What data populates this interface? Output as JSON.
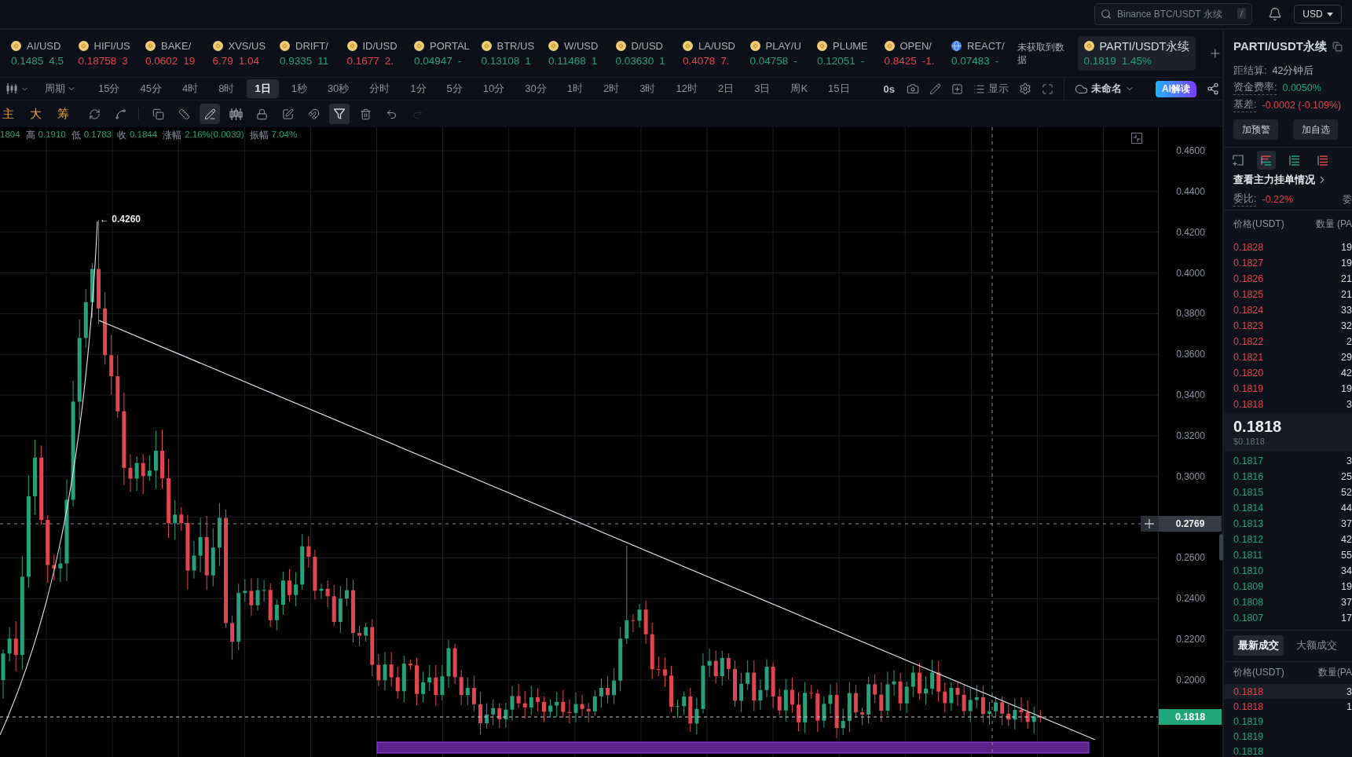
{
  "top_bar": {
    "search": {
      "placeholder": "Binance BTC/USDT 永续",
      "shortcut": "/"
    },
    "currency": "USD"
  },
  "tickers": [
    {
      "kind": "coin",
      "symbol": "AI/USD",
      "price": "0.1485",
      "change": "4.5",
      "rising": true,
      "selected": false
    },
    {
      "kind": "coin",
      "symbol": "HIFI/US",
      "price": "0.18758",
      "change": "3",
      "rising": false,
      "selected": false
    },
    {
      "kind": "coin",
      "symbol": "BAKE/",
      "price": "0.0602",
      "change": "19",
      "rising": false,
      "selected": false
    },
    {
      "kind": "coin",
      "symbol": "XVS/US",
      "price": "6.79",
      "change": "1.04",
      "rising": false,
      "selected": false
    },
    {
      "kind": "coin",
      "symbol": "DRIFT/",
      "price": "0.9335",
      "change": "11",
      "rising": true,
      "selected": false
    },
    {
      "kind": "coin",
      "symbol": "ID/USD",
      "price": "0.1677",
      "change": "2.",
      "rising": false,
      "selected": false
    },
    {
      "kind": "coin",
      "symbol": "PORTAL",
      "price": "0.04947",
      "change": "-",
      "rising": true,
      "selected": false
    },
    {
      "kind": "coin",
      "symbol": "BTR/US",
      "price": "0.13108",
      "change": "1",
      "rising": true,
      "selected": false
    },
    {
      "kind": "coin",
      "symbol": "W/USD",
      "price": "0.11468",
      "change": "1",
      "rising": true,
      "selected": false
    },
    {
      "kind": "coin",
      "symbol": "D/USD",
      "price": "0.03630",
      "change": "1",
      "rising": true,
      "selected": false
    },
    {
      "kind": "coin",
      "symbol": "LA/USD",
      "price": "0.4078",
      "change": "7.",
      "rising": false,
      "selected": false
    },
    {
      "kind": "coin",
      "symbol": "PLAY/U",
      "price": "0.04758",
      "change": "-",
      "rising": true,
      "selected": false
    },
    {
      "kind": "coin",
      "symbol": "PLUME",
      "price": "0.12051",
      "change": "-",
      "rising": true,
      "selected": false
    },
    {
      "kind": "coin",
      "symbol": "OPEN/",
      "price": "0.8425",
      "change": "-1.",
      "rising": false,
      "selected": false
    },
    {
      "kind": "globe",
      "symbol": "REACT/",
      "price": "0.07483",
      "change": "-",
      "rising": true,
      "selected": false
    },
    {
      "kind": "notice",
      "label": "未获取到数据",
      "selected": false
    },
    {
      "kind": "coin",
      "symbol": "PARTI/USDT永续",
      "price": "0.1819",
      "change": "1.45%",
      "rising": true,
      "selected": true
    }
  ],
  "period_bar": {
    "period_menu": "周期",
    "periods": [
      {
        "label": "15分",
        "selected": false
      },
      {
        "label": "45分",
        "selected": false
      },
      {
        "label": "4时",
        "selected": false
      },
      {
        "label": "8时",
        "selected": false
      },
      {
        "label": "1日",
        "selected": true
      },
      {
        "label": "1秒",
        "selected": false
      },
      {
        "label": "30秒",
        "selected": false
      },
      {
        "label": "分时",
        "selected": false
      },
      {
        "label": "1分",
        "selected": false
      },
      {
        "label": "5分",
        "selected": false
      },
      {
        "label": "10分",
        "selected": false
      },
      {
        "label": "30分",
        "selected": false
      },
      {
        "label": "1时",
        "selected": false
      },
      {
        "label": "2时",
        "selected": false
      },
      {
        "label": "3时",
        "selected": false
      },
      {
        "label": "12时",
        "selected": false
      },
      {
        "label": "2日",
        "selected": false
      },
      {
        "label": "3日",
        "selected": false
      },
      {
        "label": "周K",
        "selected": false
      },
      {
        "label": "15日",
        "selected": false
      }
    ],
    "countdown": "0s",
    "display_label": "显示",
    "layout_name": "未命名",
    "ai_button": "AI解读"
  },
  "tool_bar": {
    "indicator_buttons": [
      "主",
      "大",
      "筹"
    ],
    "tools": [
      {
        "selected": false,
        "disabled": false
      },
      {
        "selected": false,
        "disabled": false
      },
      {
        "selected": false,
        "disabled": false
      },
      {
        "selected": false,
        "disabled": false
      },
      {
        "selected": true,
        "disabled": false
      },
      {
        "selected": false,
        "disabled": false
      },
      {
        "selected": false,
        "disabled": false
      },
      {
        "selected": false,
        "disabled": false
      },
      {
        "selected": false,
        "disabled": false
      },
      {
        "selected": true,
        "disabled": false
      },
      {
        "selected": false,
        "disabled": false
      },
      {
        "selected": false,
        "disabled": false
      },
      {
        "selected": false,
        "disabled": true
      }
    ]
  },
  "legend": [
    {
      "value": "1804"
    },
    {
      "label": "高",
      "value": "0.1910"
    },
    {
      "label": "低",
      "value": "0.1783"
    },
    {
      "label": "收",
      "value": "0.1844"
    },
    {
      "label": "涨幅",
      "value": "2.16%(0.0039)"
    },
    {
      "label": "振幅",
      "value": "7.04%"
    }
  ],
  "chart": {
    "peak_label": "← 0.4260",
    "axis_upper": [
      "0.4600",
      "0.4400",
      "0.4200",
      "0.4000",
      "0.3800",
      "0.3600",
      "0.3400",
      "0.3200",
      "0.3000"
    ],
    "crosshair_price": "0.2769",
    "axis_lower": [
      "0.2600",
      "0.2400",
      "0.2200",
      "0.2000"
    ],
    "last_price": "0.1818"
  },
  "panel": {
    "title": "PARTI/USDT永续",
    "stats": [
      {
        "label": "距结算:",
        "value": "42分钟后",
        "color": "#a7acb7",
        "tooltip": false
      },
      {
        "label": "资金费率:",
        "value": "0.0050%",
        "color": "#26a17b",
        "tooltip": true
      },
      {
        "label": "基差:",
        "value": "-0.0002 (-0.109%)",
        "color": "#e0464f",
        "tooltip": true
      }
    ],
    "buttons": [
      "加预警",
      "加自选"
    ],
    "views": [
      {
        "selected": false
      },
      {
        "selected": true
      },
      {
        "selected": false
      },
      {
        "selected": false
      }
    ],
    "depth_link": "查看主力挂单情况",
    "ratio": {
      "label": "委比:",
      "value": "-0.22%",
      "tooltip": true
    },
    "ratio_next_label": "委",
    "book_columns": [
      "价格(USDT)",
      "数量 (PA"
    ],
    "asks": [
      {
        "price": "0.1828",
        "qty": "19"
      },
      {
        "price": "0.1827",
        "qty": "19"
      },
      {
        "price": "0.1826",
        "qty": "21"
      },
      {
        "price": "0.1825",
        "qty": "21"
      },
      {
        "price": "0.1824",
        "qty": "33"
      },
      {
        "price": "0.1823",
        "qty": "32"
      },
      {
        "price": "0.1822",
        "qty": "2"
      },
      {
        "price": "0.1821",
        "qty": "29"
      },
      {
        "price": "0.1820",
        "qty": "42"
      },
      {
        "price": "0.1819",
        "qty": "19"
      },
      {
        "price": "0.1818",
        "qty": "3"
      }
    ],
    "last_price": "0.1818",
    "last_price_usd": "$0.1818",
    "bids": [
      {
        "price": "0.1817",
        "qty": "3"
      },
      {
        "price": "0.1816",
        "qty": "25"
      },
      {
        "price": "0.1815",
        "qty": "52"
      },
      {
        "price": "0.1814",
        "qty": "44"
      },
      {
        "price": "0.1813",
        "qty": "37"
      },
      {
        "price": "0.1812",
        "qty": "42"
      },
      {
        "price": "0.1811",
        "qty": "55"
      },
      {
        "price": "0.1810",
        "qty": "34"
      },
      {
        "price": "0.1809",
        "qty": "19"
      },
      {
        "price": "0.1808",
        "qty": "37"
      },
      {
        "price": "0.1807",
        "qty": "17"
      }
    ],
    "trade_tabs": [
      {
        "label": "最新成交",
        "selected": true
      },
      {
        "label": "大额成交",
        "selected": false
      }
    ],
    "trade_columns": [
      "价格(USDT)",
      "数量(PA"
    ],
    "trades": [
      {
        "price": "0.1818",
        "qty": "3",
        "rising": false,
        "selected": true
      },
      {
        "price": "0.1818",
        "qty": "1",
        "rising": false,
        "selected": false
      },
      {
        "price": "0.1819",
        "rising": true,
        "selected": false
      },
      {
        "price": "0.1819",
        "rising": true,
        "selected": false
      },
      {
        "price": "0.1818",
        "rising": true,
        "selected": false
      }
    ]
  }
}
